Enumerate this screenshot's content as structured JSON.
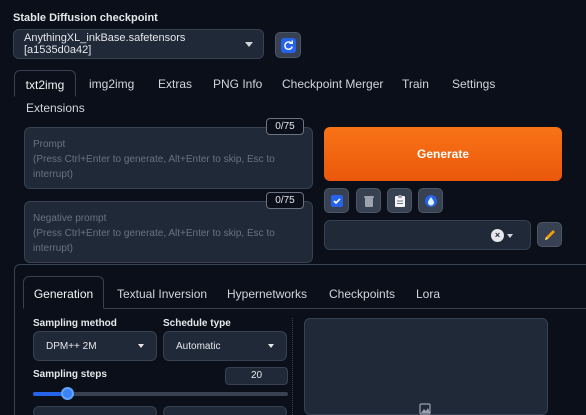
{
  "checkpoint": {
    "label": "Stable Diffusion checkpoint",
    "value": "AnythingXL_inkBase.safetensors [a1535d0a42]"
  },
  "main_tabs": [
    {
      "label": "txt2img",
      "active": true
    },
    {
      "label": "img2img"
    },
    {
      "label": "Extras"
    },
    {
      "label": "PNG Info"
    },
    {
      "label": "Checkpoint Merger"
    },
    {
      "label": "Train"
    },
    {
      "label": "Settings"
    },
    {
      "label": "Extensions"
    }
  ],
  "prompt": {
    "counter": "0/75",
    "placeholder": "Prompt\n(Press Ctrl+Enter to generate, Alt+Enter to skip, Esc to interrupt)"
  },
  "negative_prompt": {
    "counter": "0/75",
    "placeholder": "Negative prompt\n(Press Ctrl+Enter to generate, Alt+Enter to skip, Esc to interrupt)"
  },
  "generate_label": "Generate",
  "tools": [
    "checkbox-icon",
    "trash-icon",
    "clipboard-icon",
    "drop-icon"
  ],
  "style_clear": "×",
  "sub_tabs": [
    {
      "label": "Generation",
      "active": true
    },
    {
      "label": "Textual Inversion"
    },
    {
      "label": "Hypernetworks"
    },
    {
      "label": "Checkpoints"
    },
    {
      "label": "Lora"
    }
  ],
  "sampling": {
    "method_label": "Sampling method",
    "method_value": "DPM++ 2M",
    "schedule_label": "Schedule type",
    "schedule_value": "Automatic",
    "steps_label": "Sampling steps",
    "steps_value": "20",
    "steps_fraction": 0.133
  },
  "colors": {
    "background": "#0b0f19",
    "accent": "#f97316",
    "primary": "#2563eb"
  }
}
